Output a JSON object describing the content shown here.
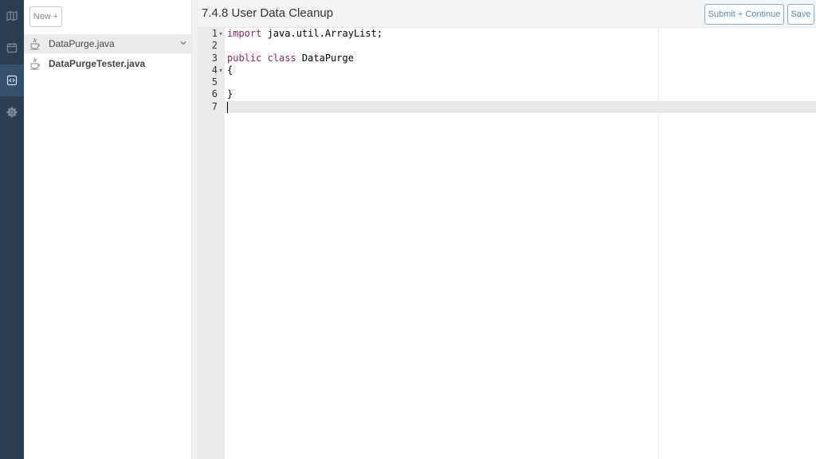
{
  "rail": {
    "items": [
      {
        "icon": "map-icon"
      },
      {
        "icon": "calendar-icon"
      },
      {
        "icon": "code-icon",
        "active": true
      },
      {
        "icon": "gear-icon"
      }
    ]
  },
  "files": {
    "new_label": "New +",
    "items": [
      {
        "name": "DataPurge.java",
        "active": true
      },
      {
        "name": "DataPurgeTester.java",
        "active": false
      }
    ]
  },
  "header": {
    "title": "7.4.8 User Data Cleanup",
    "submit_label": "Submit + Continue",
    "save_label": "Save"
  },
  "editor": {
    "line_numbers": [
      "1",
      "2",
      "3",
      "4",
      "5",
      "6",
      "7"
    ],
    "lines": [
      {
        "kw": "import",
        "rest": " java.util.ArrayList;"
      },
      {
        "kw": "",
        "rest": ""
      },
      {
        "kw": "public class",
        "rest": " DataPurge"
      },
      {
        "kw": "",
        "rest": "{"
      },
      {
        "kw": "",
        "rest": ""
      },
      {
        "kw": "",
        "rest": "}"
      },
      {
        "kw": "",
        "rest": ""
      }
    ],
    "fold_marks": [
      "1",
      "4"
    ]
  },
  "colors": {
    "rail_bg": "#2c3e50",
    "accent": "#4a8fd0",
    "keyword": "#93216c"
  }
}
